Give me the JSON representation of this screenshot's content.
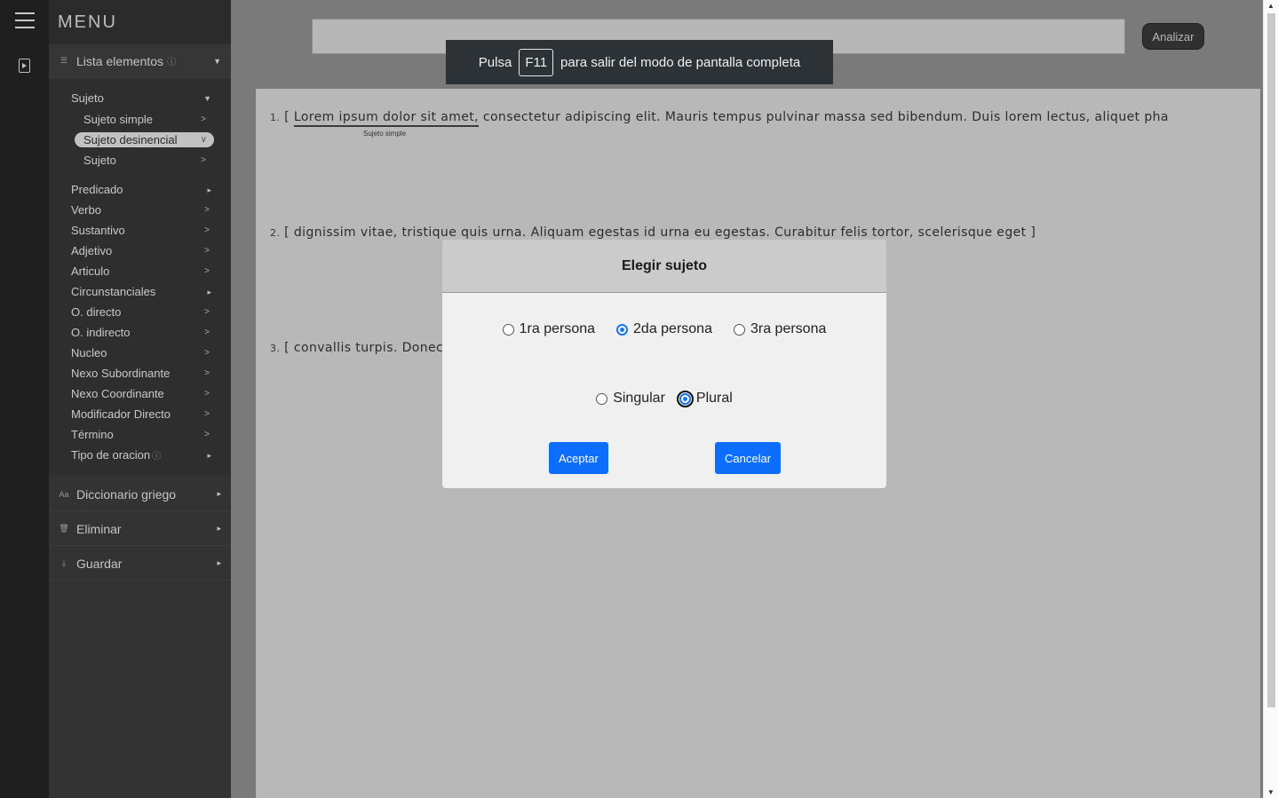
{
  "menu": {
    "title": "MENU",
    "lista_elementos": "Lista elementos",
    "info_glyph": "ⓘ",
    "sujeto_group": {
      "label": "Sujeto",
      "subitems": [
        "Sujeto simple",
        "Sujeto desinencial",
        "Sujeto"
      ],
      "active_subitem": "Sujeto desinencial"
    },
    "items": [
      {
        "label": "Predicado",
        "marker": "▸"
      },
      {
        "label": "Verbo",
        "marker": ">"
      },
      {
        "label": "Sustantivo",
        "marker": ">"
      },
      {
        "label": "Adjetivo",
        "marker": ">"
      },
      {
        "label": "Articulo",
        "marker": ">"
      },
      {
        "label": "Circunstanciales",
        "marker": "▸"
      },
      {
        "label": "O. directo",
        "marker": ">"
      },
      {
        "label": "O. indirecto",
        "marker": ">"
      },
      {
        "label": "Nucleo",
        "marker": ">"
      },
      {
        "label": "Nexo Subordinante",
        "marker": ">"
      },
      {
        "label": "Nexo Coordinante",
        "marker": ">"
      },
      {
        "label": "Modificador Directo",
        "marker": ">"
      },
      {
        "label": "Término",
        "marker": ">"
      },
      {
        "label": "Tipo de oracion",
        "marker": "▸"
      }
    ],
    "sections": [
      "Diccionario griego",
      "Eliminar",
      "Guardar"
    ]
  },
  "toolbar": {
    "analyze_label": "Analizar",
    "input_value": ""
  },
  "fullscreen_toast": {
    "prefix": "Pulsa",
    "key": "F11",
    "suffix": "para salir del modo de pantalla completa"
  },
  "document": {
    "lines": [
      {
        "num": "1.",
        "open": "[",
        "underlined": "Lorem ipsum dolor sit amet,",
        "rest": "consectetur adipiscing elit. Mauris tempus pulvinar massa sed bibendum. Duis lorem lectus, aliquet pha",
        "annotation": "Sujeto simple"
      },
      {
        "num": "2.",
        "open": "[",
        "text": "dignissim vitae, tristique quis urna. Aliquam egestas id urna eu egestas. Curabitur felis tortor, scelerisque eget",
        "close": "]"
      },
      {
        "num": "3.",
        "open": "[",
        "text": "convallis turpis. Donec"
      }
    ]
  },
  "modal": {
    "title": "Elegir sujeto",
    "persona_options": [
      "1ra persona",
      "2da persona",
      "3ra persona"
    ],
    "persona_selected": "2da persona",
    "numero_options": [
      "Singular",
      "Plural"
    ],
    "numero_selected": "Plural",
    "accept_label": "Aceptar",
    "cancel_label": "Cancelar"
  },
  "colors": {
    "primary_button": "#0d6efd",
    "radio_accent": "#1a73e8"
  }
}
